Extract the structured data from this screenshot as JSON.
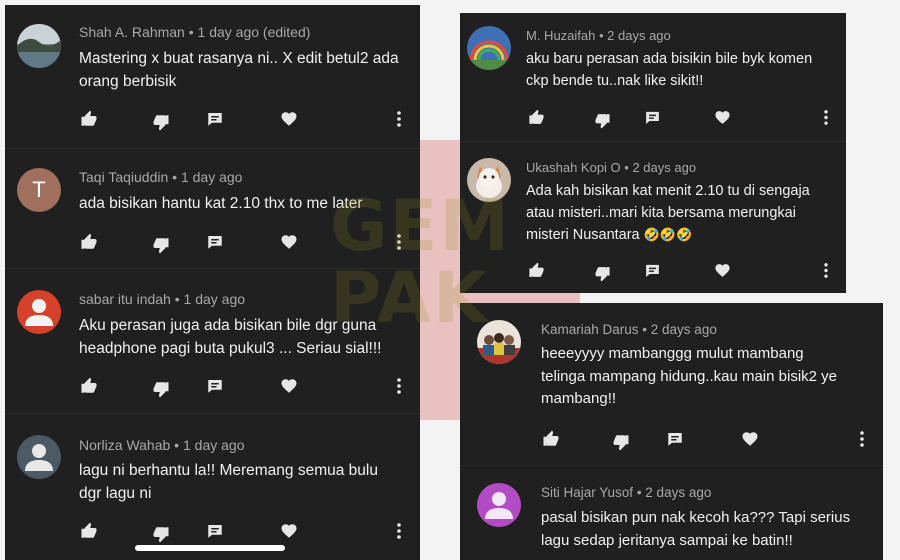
{
  "left_panel": {
    "comments": [
      {
        "author": "Shah A. Rahman",
        "time": "1 day ago (edited)",
        "lines": [
          "Mastering x buat rasanya ni.. X edit betul2 ada",
          "orang berbisik"
        ],
        "avatar": "landscape-photo"
      },
      {
        "author": "Taqi Taqiuddin",
        "time": "1 day ago",
        "lines": [
          "ada bisikan hantu kat 2.10 thx to me later"
        ],
        "avatar_letter": "T",
        "avatar_color": "#a06f5d"
      },
      {
        "author": "sabar itu indah",
        "time": "1 day ago",
        "lines": [
          "Aku perasan juga ada bisikan bile dgr guna",
          "headphone pagi buta pukul3 ... Seriau sial!!!"
        ],
        "avatar_color": "#d5412a"
      },
      {
        "author": "Norliza Wahab",
        "time": "1 day ago",
        "lines": [
          "lagu ni berhantu la!! Meremang semua bulu",
          "dgr lagu ni"
        ],
        "avatar_color": "#4c5a66"
      }
    ]
  },
  "right_top_panel": {
    "comments": [
      {
        "author": "M. Huzaifah",
        "time": "2 days ago",
        "lines": [
          "aku baru perasan ada bisikin bile byk komen",
          "ckp bende tu..nak like sikit!!"
        ],
        "avatar": "rainbow-photo"
      },
      {
        "author": "Ukashah Kopi O",
        "time": "2 days ago",
        "lines": [
          "Ada kah bisikan kat menit 2.10 tu di sengaja",
          "atau misteri..mari kita bersama merungkai",
          "misteri Nusantara"
        ],
        "emoji": "🤣🤣🤣",
        "avatar": "cat-photo"
      }
    ]
  },
  "right_bottom_panel": {
    "comments": [
      {
        "author": "Kamariah Darus",
        "time": "2 days ago",
        "lines": [
          "heeeyyyy mambanggg mulut mambang",
          "telinga mampang hidung..kau main bisik2 ye",
          "mambang!!"
        ],
        "avatar": "group-photo"
      },
      {
        "author": "Siti Hajar Yusof",
        "time": "2 days ago",
        "lines": [
          "pasal bisikan pun nak kecoh ka??? Tapi serius",
          "lagu sedap jeritanya sampai ke batin!!"
        ],
        "avatar_color": "#b24bc4"
      }
    ]
  },
  "watermark": {
    "text_line1": "GEM",
    "text_line2": "PAK"
  },
  "colors": {
    "panel_bg": "#202020",
    "meta": "#a8a8a8",
    "text": "#f1f1f1",
    "icon": "#e6e6e6",
    "page_bg": "#f3f3f3"
  },
  "icons": [
    "thumbs-up-icon",
    "thumbs-down-icon",
    "reply-icon",
    "heart-icon",
    "more-vert-icon"
  ]
}
